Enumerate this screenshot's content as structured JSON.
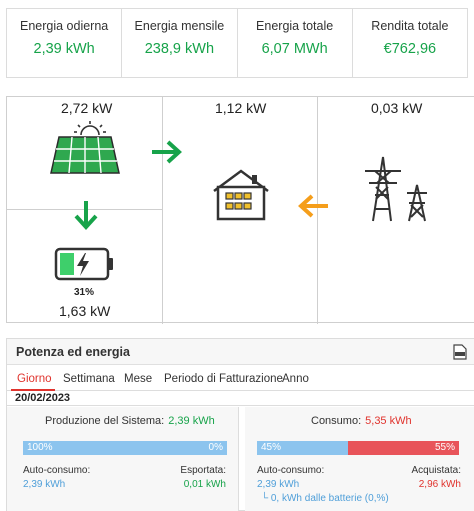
{
  "stats": [
    {
      "label": "Energia odierna",
      "value": "2,39 kWh"
    },
    {
      "label": "Energia mensile",
      "value": "238,9 kWh"
    },
    {
      "label": "Energia totale",
      "value": "6,07 MWh"
    },
    {
      "label": "Rendita totale",
      "value": "€762,96"
    }
  ],
  "flow": {
    "solar_power": "2,72 kW",
    "home_power": "1,12 kW",
    "grid_power": "0,03 kW",
    "battery_percent": "31%",
    "battery_level": 0.31,
    "battery_power": "1,63 kW",
    "icons": [
      "solar-panel-icon",
      "house-icon",
      "power-tower-icon",
      "battery-icon",
      "arrow-right-icon",
      "arrow-down-icon",
      "arrow-left-icon"
    ],
    "colors": {
      "solar_arrow": "#17a34a",
      "battery_arrow": "#17a34a",
      "grid_arrow": "#f59e1b",
      "battery_fill": "#3ecf6b",
      "panel_green": "#2fa84f"
    }
  },
  "panel": {
    "title": "Potenza ed energia",
    "export_icon": "pdf-export-icon",
    "tabs": [
      "Giorno",
      "Settimana",
      "Mese",
      "Periodo di Fatturazione",
      "Anno"
    ],
    "active_tab": "Giorno",
    "date": "20/02/2023",
    "production": {
      "title": "Produzione del Sistema:",
      "value": "2,39 kWh",
      "bar_left": "100%",
      "bar_right": "0%",
      "self_label": "Auto-consumo:",
      "self_value": "2,39 kWh",
      "export_label": "Esportata:",
      "export_value": "0,01 kWh"
    },
    "consumption": {
      "title": "Consumo:",
      "value": "5,35 kWh",
      "bar_left": "45%",
      "bar_right": "55%",
      "self_label": "Auto-consumo:",
      "self_value": "2,39 kWh",
      "battery_note": "└ 0, kWh dalle batterie (0,%)",
      "bought_label": "Acquistata:",
      "bought_value": "2,96 kWh"
    },
    "colors": {
      "bar_blue": "#8cc4ee",
      "bar_red": "#e8545a",
      "active_tab": "#e0332d"
    }
  }
}
